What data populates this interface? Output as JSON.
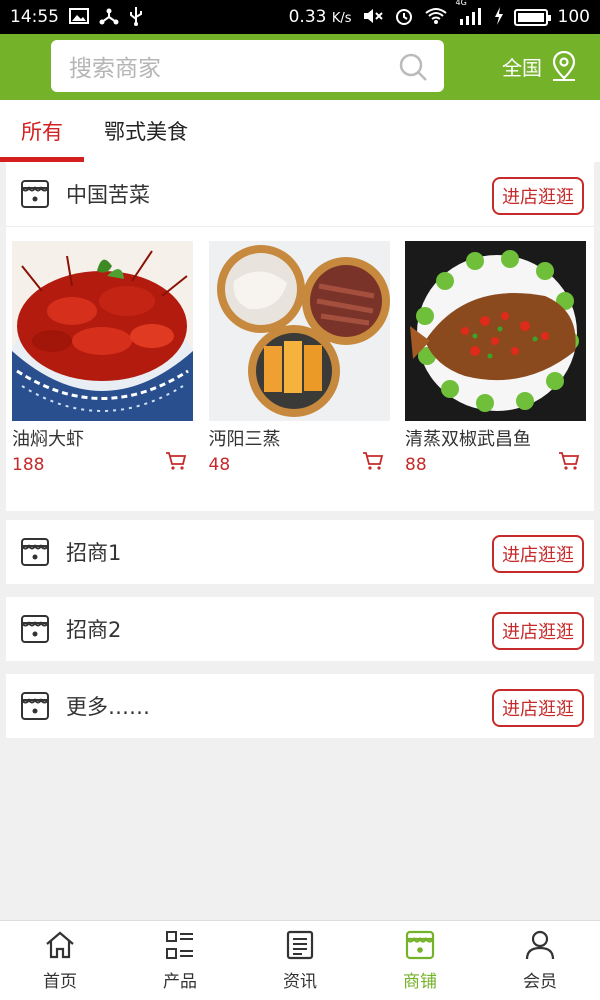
{
  "status_bar": {
    "time": "14:55",
    "speed": "0.33",
    "speed_unit": "K/s",
    "signal_label": "4G",
    "battery": "100"
  },
  "header": {
    "search_placeholder": "搜索商家",
    "region": "全国"
  },
  "tabs": [
    {
      "label": "所有",
      "active": true
    },
    {
      "label": "鄂式美食",
      "active": false
    }
  ],
  "stores": [
    {
      "name": "中国苦菜",
      "button": "进店逛逛",
      "products": [
        {
          "name": "油焖大虾",
          "price": "188",
          "image": "crayfish-bowl"
        },
        {
          "name": "沔阳三蒸",
          "price": "48",
          "image": "steamed-dishes"
        },
        {
          "name": "清蒸双椒武昌鱼",
          "price": "88",
          "image": "steamed-fish"
        }
      ]
    },
    {
      "name": "招商1",
      "button": "进店逛逛"
    },
    {
      "name": "招商2",
      "button": "进店逛逛"
    },
    {
      "name": "更多……",
      "button": "进店逛逛"
    }
  ],
  "bottom_nav": [
    {
      "label": "首页",
      "icon": "home-icon",
      "active": false
    },
    {
      "label": "产品",
      "icon": "grid-list-icon",
      "active": false
    },
    {
      "label": "资讯",
      "icon": "news-icon",
      "active": false
    },
    {
      "label": "商铺",
      "icon": "store-icon",
      "active": true
    },
    {
      "label": "会员",
      "icon": "user-icon",
      "active": false
    }
  ],
  "colors": {
    "brand_green": "#74b22a",
    "accent_red": "#c62a2a",
    "tab_red": "#d31f1f"
  }
}
